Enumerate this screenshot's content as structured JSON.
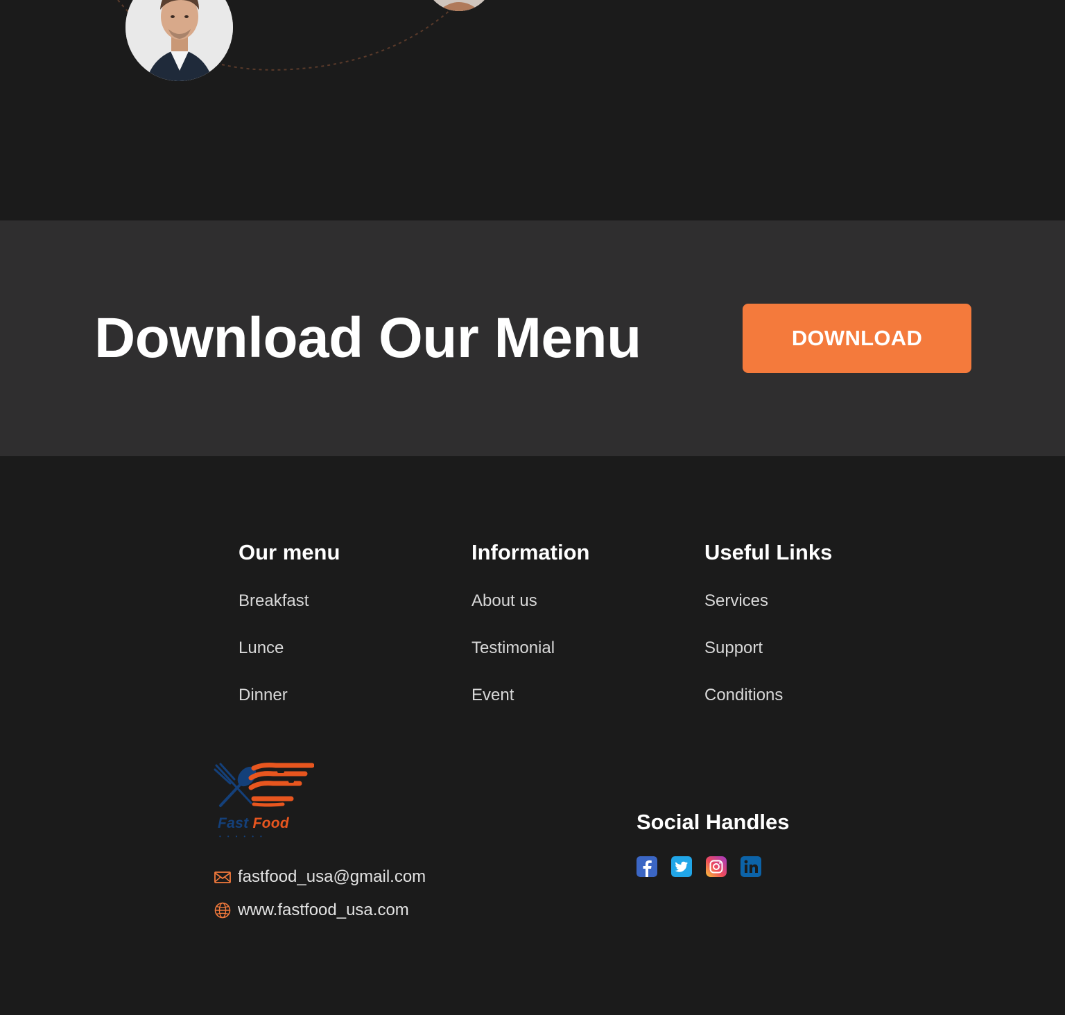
{
  "download": {
    "title": "Download Our Menu",
    "button_label": "DOWNLOAD"
  },
  "footer": {
    "columns": [
      {
        "heading": "Our menu",
        "links": [
          "Breakfast",
          "Lunce",
          "Dinner"
        ]
      },
      {
        "heading": "Information",
        "links": [
          "About us",
          "Testimonial",
          "Event"
        ]
      },
      {
        "heading": "Useful Links",
        "links": [
          "Services",
          "Support",
          "Conditions"
        ]
      }
    ],
    "logo": {
      "text_main": "Fast",
      "text_accent": "Food"
    },
    "contact": {
      "email": "fastfood_usa@gmail.com",
      "website": "www.fastfood_usa.com"
    },
    "social": {
      "heading": "Social Handles",
      "icons": [
        "facebook-icon",
        "twitter-icon",
        "instagram-icon",
        "linkedin-icon"
      ]
    }
  },
  "colors": {
    "page_bg": "#1b1b1b",
    "band_bg": "#2f2e2f",
    "accent": "#f47a3c",
    "logo_blue": "#14407a",
    "logo_orange": "#e8561f"
  }
}
